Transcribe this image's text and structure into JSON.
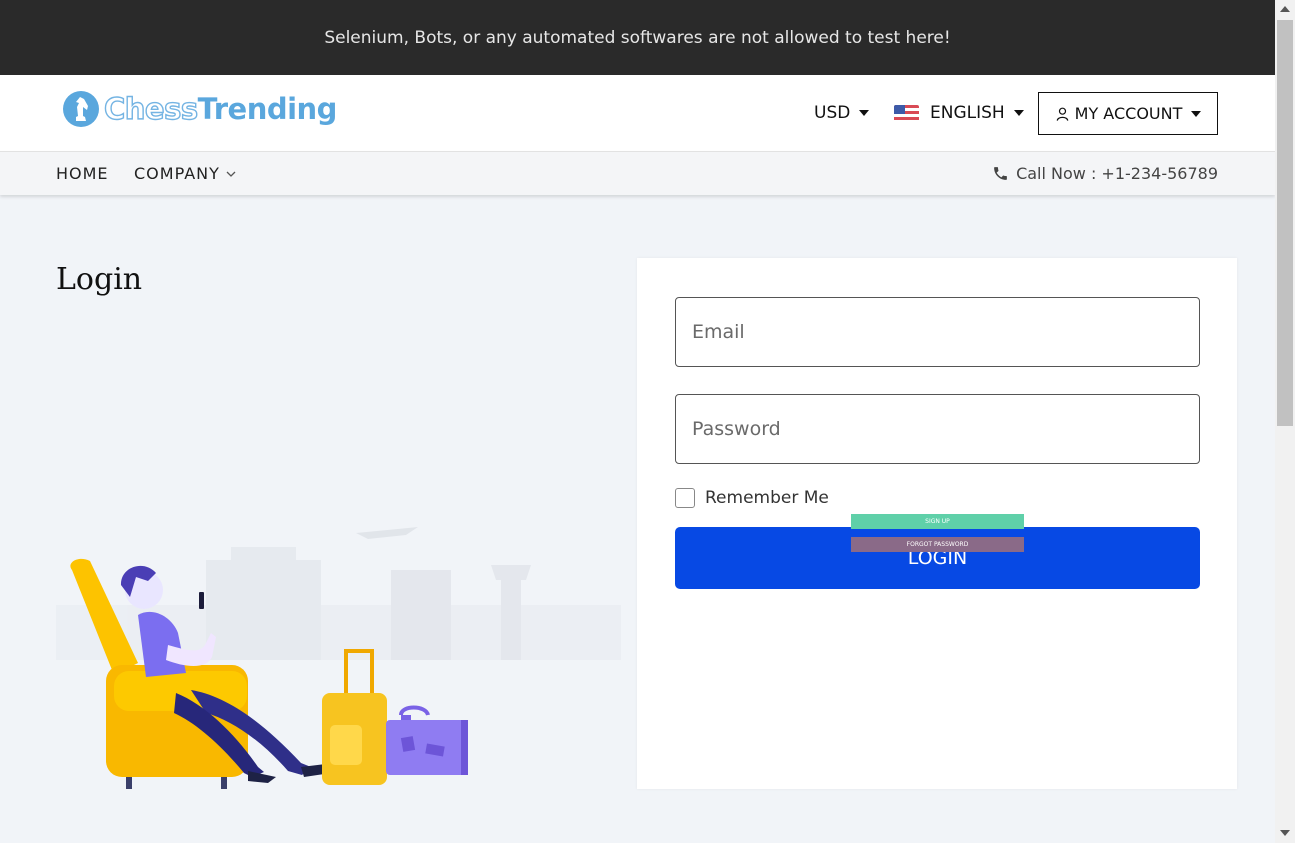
{
  "notice": {
    "text": "Selenium, Bots, or any automated softwares are not allowed to test here!"
  },
  "header": {
    "logo_part1": "Chess",
    "logo_part2": "Trending",
    "currency": "USD",
    "language": "ENGLISH",
    "account": "MY ACCOUNT"
  },
  "nav": {
    "items": [
      {
        "label": "HOME"
      },
      {
        "label": "COMPANY"
      }
    ],
    "phone": "Call Now : +1-234-56789"
  },
  "page": {
    "title": "Login"
  },
  "form": {
    "email_placeholder": "Email",
    "password_placeholder": "Password",
    "remember_label": "Remember Me",
    "login_label": "LOGIN",
    "signup_label": "SIGN UP",
    "forgot_label": "FORGOT PASSWORD"
  },
  "colors": {
    "primary_button": "#0749e4",
    "signup": "#5fd0a9",
    "forgot": "#8a6a88",
    "topbar": "#2a2a2a",
    "logo": "#5aa7dd"
  }
}
